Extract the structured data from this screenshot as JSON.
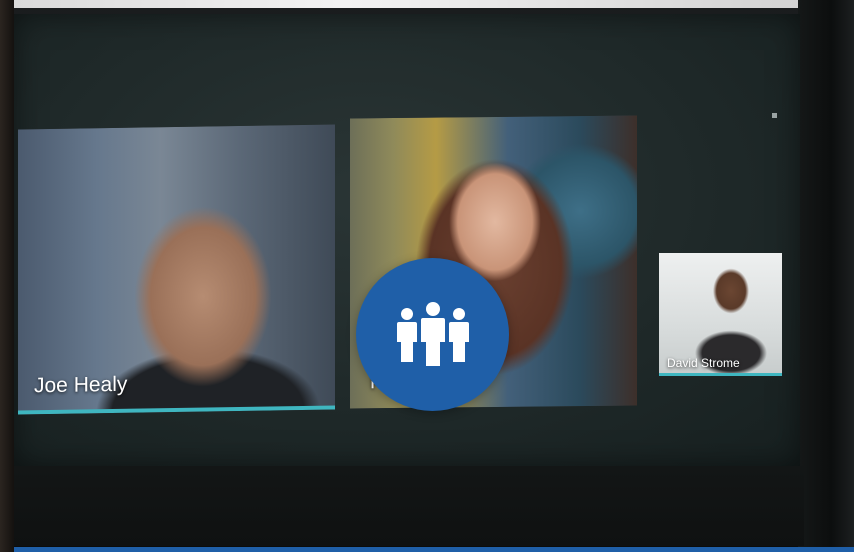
{
  "participants": [
    {
      "name": "Joe Healy"
    },
    {
      "name": "F"
    },
    {
      "name": "David Strome"
    }
  ],
  "overlay": {
    "icon": "group-people-icon",
    "color": "#1f5fa8"
  },
  "accent_color": "#3fb6c0"
}
